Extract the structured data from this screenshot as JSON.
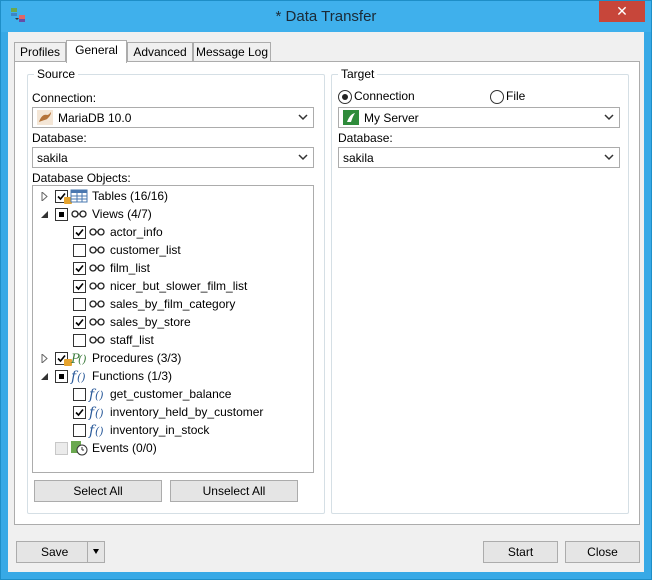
{
  "window": {
    "title": "* Data Transfer",
    "close_glyph": "✕"
  },
  "tabs": [
    {
      "label": "Profiles"
    },
    {
      "label": "General"
    },
    {
      "label": "Advanced"
    },
    {
      "label": "Message Log"
    }
  ],
  "source": {
    "group_title": "Source",
    "connection_label": "Connection:",
    "connection_value": "MariaDB 10.0",
    "database_label": "Database:",
    "database_value": "sakila",
    "objects_label": "Database Objects:"
  },
  "tree": [
    {
      "label": "Tables  (16/16)",
      "level": 0,
      "expander": "collapsed",
      "checked": "checked",
      "icon": "table-icon",
      "locked": true
    },
    {
      "label": "Views  (4/7)",
      "level": 0,
      "expander": "expanded",
      "checked": "partial",
      "icon": "view-icon"
    },
    {
      "label": "actor_info",
      "level": 1,
      "checked": "checked",
      "icon": "view-icon"
    },
    {
      "label": "customer_list",
      "level": 1,
      "checked": "unchecked",
      "icon": "view-icon"
    },
    {
      "label": "film_list",
      "level": 1,
      "checked": "checked",
      "icon": "view-icon"
    },
    {
      "label": "nicer_but_slower_film_list",
      "level": 1,
      "checked": "checked",
      "icon": "view-icon"
    },
    {
      "label": "sales_by_film_category",
      "level": 1,
      "checked": "unchecked",
      "icon": "view-icon"
    },
    {
      "label": "sales_by_store",
      "level": 1,
      "checked": "checked",
      "icon": "view-icon"
    },
    {
      "label": "staff_list",
      "level": 1,
      "checked": "unchecked",
      "icon": "view-icon"
    },
    {
      "label": "Procedures  (3/3)",
      "level": 0,
      "expander": "collapsed",
      "checked": "checked",
      "icon": "procedure-icon",
      "locked": true
    },
    {
      "label": "Functions  (1/3)",
      "level": 0,
      "expander": "expanded",
      "checked": "partial",
      "icon": "function-icon"
    },
    {
      "label": "get_customer_balance",
      "level": 1,
      "checked": "unchecked",
      "icon": "function-icon"
    },
    {
      "label": "inventory_held_by_customer",
      "level": 1,
      "checked": "checked",
      "icon": "function-icon"
    },
    {
      "label": "inventory_in_stock",
      "level": 1,
      "checked": "unchecked",
      "icon": "function-icon"
    },
    {
      "label": "Events  (0/0)",
      "level": 0,
      "expander": "none",
      "checked": "disabled",
      "icon": "event-icon"
    }
  ],
  "source_buttons": {
    "select_all": "Select All",
    "unselect_all": "Unselect All"
  },
  "target": {
    "group_title": "Target",
    "radio_connection": "Connection",
    "radio_file": "File",
    "selected": "connection",
    "connection_value": "My Server",
    "database_label": "Database:",
    "database_value": "sakila"
  },
  "footer": {
    "save": "Save",
    "start": "Start",
    "close": "Close"
  },
  "colors": {
    "titlebar": "#3fb0ec",
    "close": "#c7463a",
    "mariadb": "#b5743a",
    "server": "#2e8b3a"
  }
}
